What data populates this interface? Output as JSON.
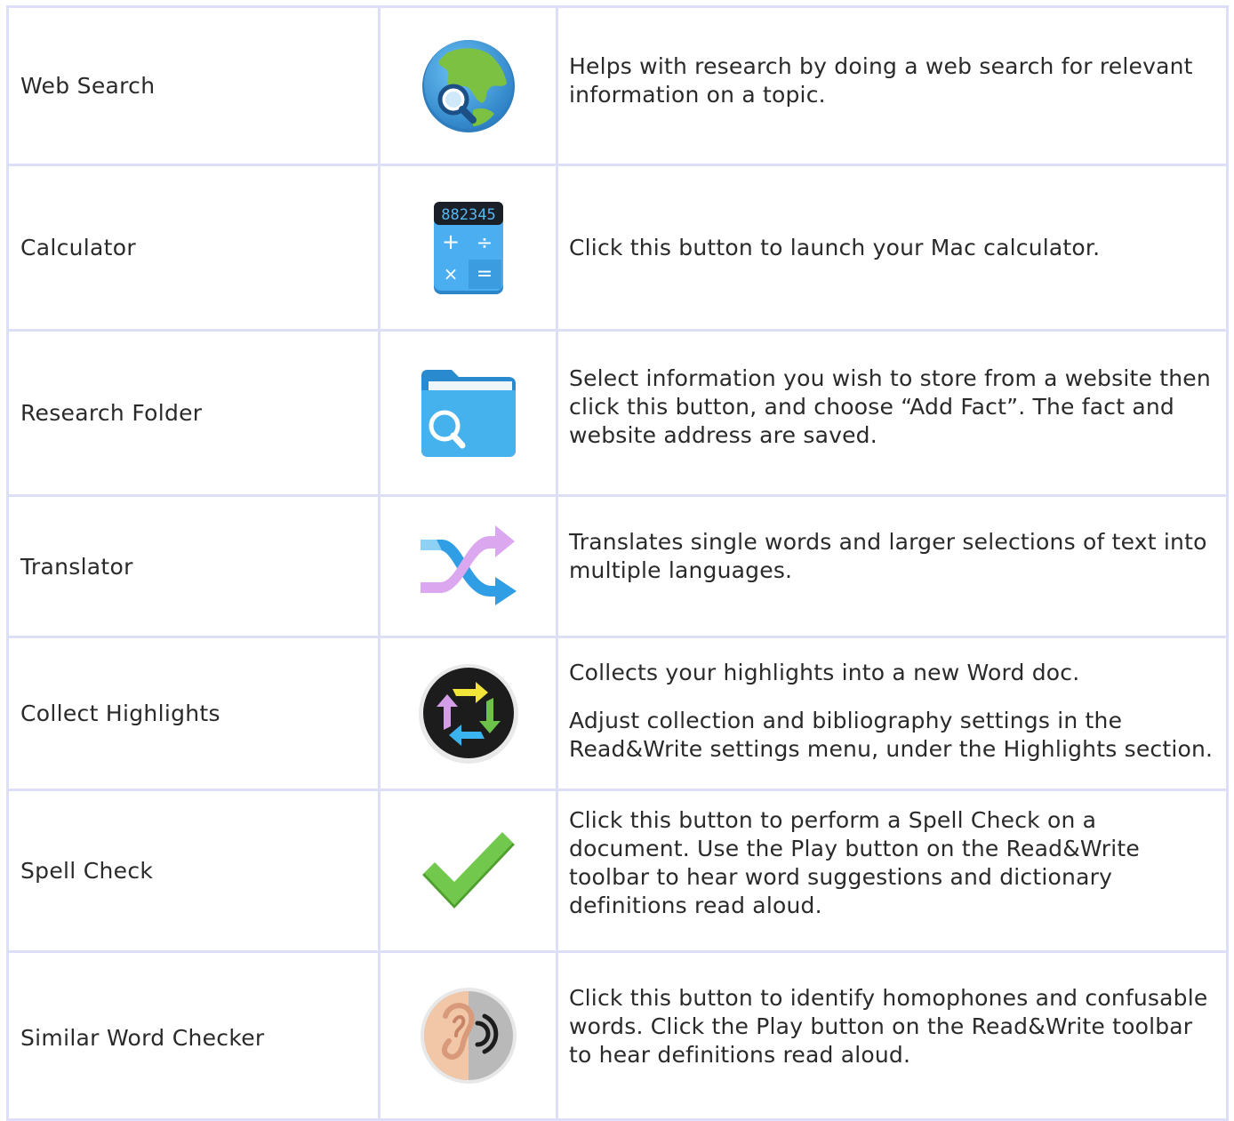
{
  "rows": [
    {
      "name": "Web Search",
      "icon": "web-search-icon",
      "description": [
        "Helps with research by doing a web search for relevant information on a topic."
      ]
    },
    {
      "name": "Calculator",
      "icon": "calculator-icon",
      "display": "882345",
      "description": [
        "Click this button to launch your Mac calculator."
      ]
    },
    {
      "name": "Research Folder",
      "icon": "research-folder-icon",
      "description": [
        "Select information you wish to store from a website then click this button, and choose “Add Fact”. The fact and website address are saved."
      ]
    },
    {
      "name": "Translator",
      "icon": "translator-icon",
      "description": [
        "Translates single words and larger selections of text into multiple languages."
      ]
    },
    {
      "name": "Collect Highlights",
      "icon": "collect-highlights-icon",
      "description": [
        "Collects your highlights into a new Word doc.",
        "Adjust collection and bibliography settings in the Read&Write settings menu, under the Highlights section."
      ]
    },
    {
      "name": "Spell Check",
      "icon": "spell-check-icon",
      "description": [
        "Click this button to perform a Spell Check on a document. Use the Play button on the Read&Write toolbar to hear word suggestions and dictionary definitions read aloud."
      ]
    },
    {
      "name": "Similar Word Checker",
      "icon": "similar-word-checker-icon",
      "description": [
        "Click this button to identify homophones and confusable words. Click the Play button on the Read&Write toolbar to hear definitions read aloud."
      ]
    }
  ],
  "colors": {
    "border": "#dcdff7",
    "text": "#2a2a2a",
    "globe_ocean": "#3d9ad9",
    "globe_land": "#7cc142",
    "calculator_blue": "#4aaef0",
    "folder_blue": "#3ea9e8",
    "checkmark_green": "#6cc24a"
  }
}
